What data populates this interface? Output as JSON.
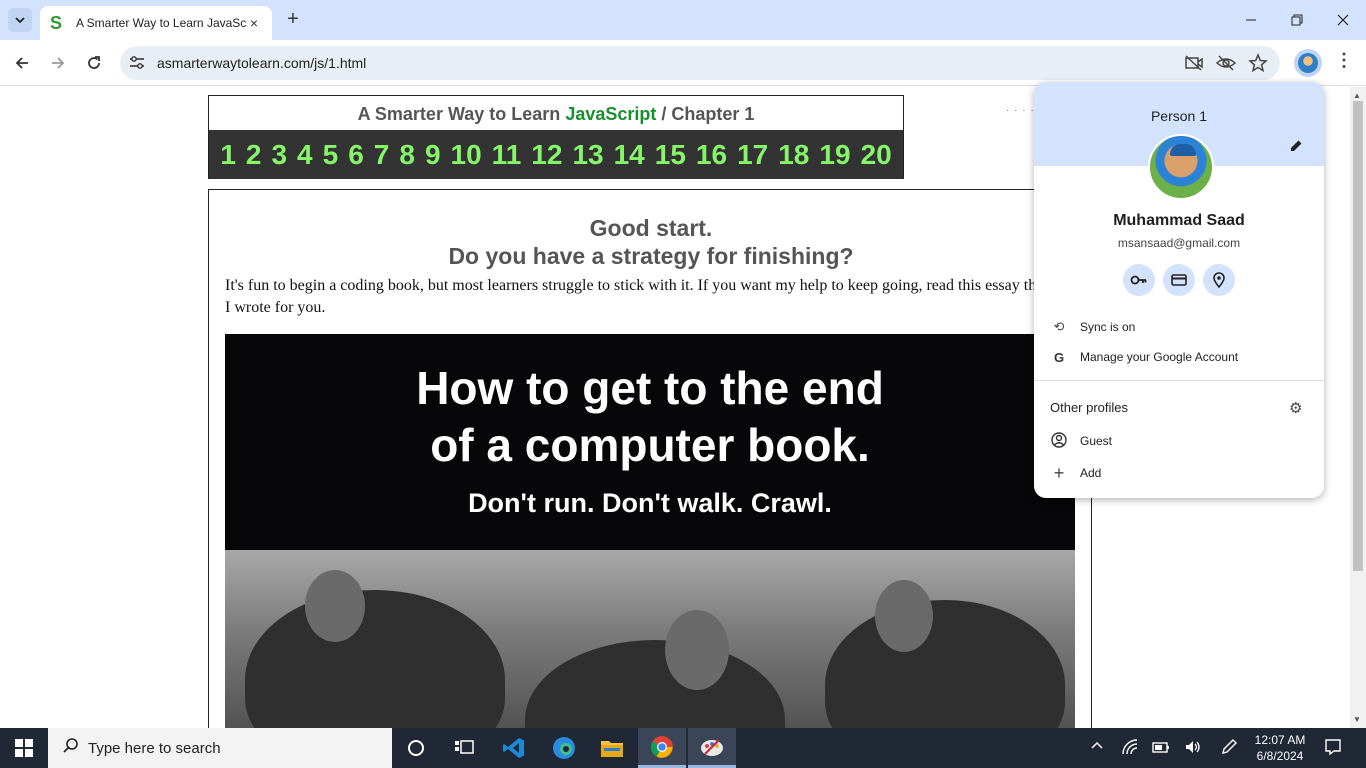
{
  "browser": {
    "tab_title": "A Smarter Way to Learn JavaScri",
    "tab_favicon": "S",
    "url": "asmarterwaytolearn.com/js/1.html",
    "new_tab_label": "+",
    "close_tab_label": "×"
  },
  "page": {
    "header_prefix": "A Smarter Way to Learn ",
    "header_js": "JavaScript",
    "header_suffix": "  /  Chapter 1",
    "chapters": [
      "1",
      "2",
      "3",
      "4",
      "5",
      "6",
      "7",
      "8",
      "9",
      "10",
      "11",
      "12",
      "13",
      "14",
      "15",
      "16",
      "17",
      "18",
      "19",
      "20"
    ],
    "heading_line1": "Good start.",
    "heading_line2": "Do you have a strategy for finishing?",
    "intro": "It's fun to begin a coding book, but most learners struggle to stick with it. If you want my help to keep going, read this essay that I wrote for you.",
    "banner_title_line1": "How to get to the end",
    "banner_title_line2": "of a computer book.",
    "banner_subtitle": "Don't run. Don't walk. Crawl."
  },
  "profile_popup": {
    "person_label": "Person 1",
    "name": "Muhammad Saad",
    "email": "msansaad@gmail.com",
    "sync": "Sync is on",
    "manage": "Manage your Google Account",
    "other_profiles": "Other profiles",
    "guest": "Guest",
    "add": "Add"
  },
  "taskbar": {
    "search_placeholder": "Type here to search",
    "time": "12:07 AM",
    "date": "6/8/2024"
  },
  "colors": {
    "accent": "#d3e3fd",
    "chapter_numbers": "#86f56a",
    "js_green": "#1a8f2e"
  }
}
